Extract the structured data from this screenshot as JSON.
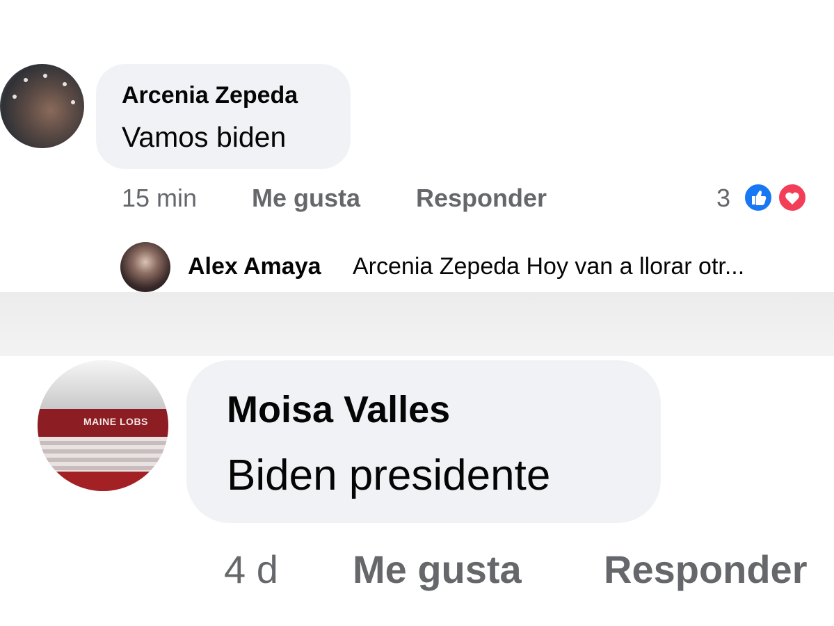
{
  "comment1": {
    "author": "Arcenia Zepeda",
    "text": "Vamos biden",
    "time": "15 min",
    "like_label": "Me gusta",
    "reply_label": "Responder",
    "reaction_count": "3",
    "reactions": [
      "like-icon",
      "love-icon"
    ],
    "reply": {
      "author": "Alex Amaya",
      "text": "Arcenia Zepeda Hoy van a llorar otr..."
    }
  },
  "comment2": {
    "author": "Moisa Valles",
    "text": "Biden presidente",
    "time": "4 d",
    "like_label": "Me gusta",
    "reply_label": "Responder",
    "avatar_sign": "MAINE LOBS"
  },
  "colors": {
    "bubble": "#f0f2f5",
    "meta_text": "#65676b",
    "like_blue": "#1877f2",
    "love_red": "#f33e58"
  }
}
